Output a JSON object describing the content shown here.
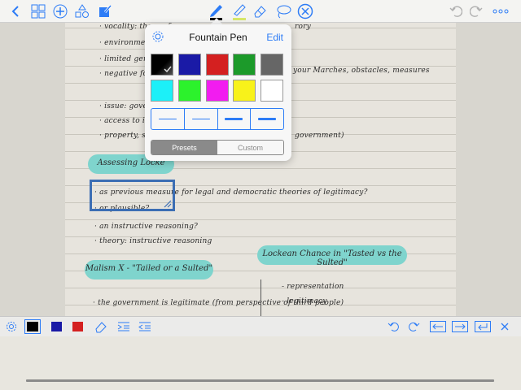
{
  "toolbar": {
    "left_icons": [
      "back-icon",
      "grid-icon",
      "add-icon",
      "shapes-icon",
      "edit-icon"
    ],
    "center_tools": [
      "pen-icon",
      "highlighter-icon",
      "eraser-icon",
      "lasso-icon",
      "close-circle-icon"
    ],
    "right_icons": [
      "undo-icon",
      "redo-icon",
      "more-icon"
    ],
    "accent": "#2d7cf6"
  },
  "popup": {
    "title": "Fountain Pen",
    "edit_label": "Edit",
    "colors": [
      "#000000",
      "#1a1aa6",
      "#d42020",
      "#1c9a2a",
      "#666666",
      "#1cf0f8",
      "#2cf22c",
      "#f21cf0",
      "#f8f21a",
      "#ffffff"
    ],
    "selected_color": "#000000",
    "widths": [
      1,
      1.5,
      2.5,
      3
    ],
    "tabs": {
      "presets": "Presets",
      "custom": "Custom",
      "active": "presets"
    }
  },
  "note": {
    "lines": [
      "· vocality: the prof",
      "· environmental w",
      "· limited genuin",
      "  · negative for",
      "· issue: governme",
      "· access to informat",
      "· property, security",
      "· as previous measure for legal and democratic theories of legitimacy?",
      "  · or plausible?",
      "· an instructive reasoning?",
      "· theory: instructive reasoning",
      "· the government is legitimate (from perspective of third people)",
      "- representation",
      "- legitimacy",
      "rory",
      "your Marches, obstacles, measures",
      "government)"
    ],
    "highlights": {
      "assessing": "Assessing Locke",
      "lockean": "Lockean Chance in \"Tasted vs the Sulted\"",
      "malism": "Malism X - \"Tailed or a Sulted\""
    }
  },
  "bottom_toolbar": {
    "left_icons": [
      "settings-icon",
      "black-color-swatch",
      "blue-color-swatch",
      "red-color-swatch",
      "eraser-icon",
      "indent-icon",
      "outdent-icon"
    ],
    "right_icons": [
      "undo-icon",
      "redo-icon",
      "arrow-left-box-icon",
      "arrow-right-box-icon",
      "return-icon",
      "close-icon"
    ],
    "swatch_colors": [
      "#000000",
      "#1a1aa6",
      "#d42020"
    ]
  }
}
